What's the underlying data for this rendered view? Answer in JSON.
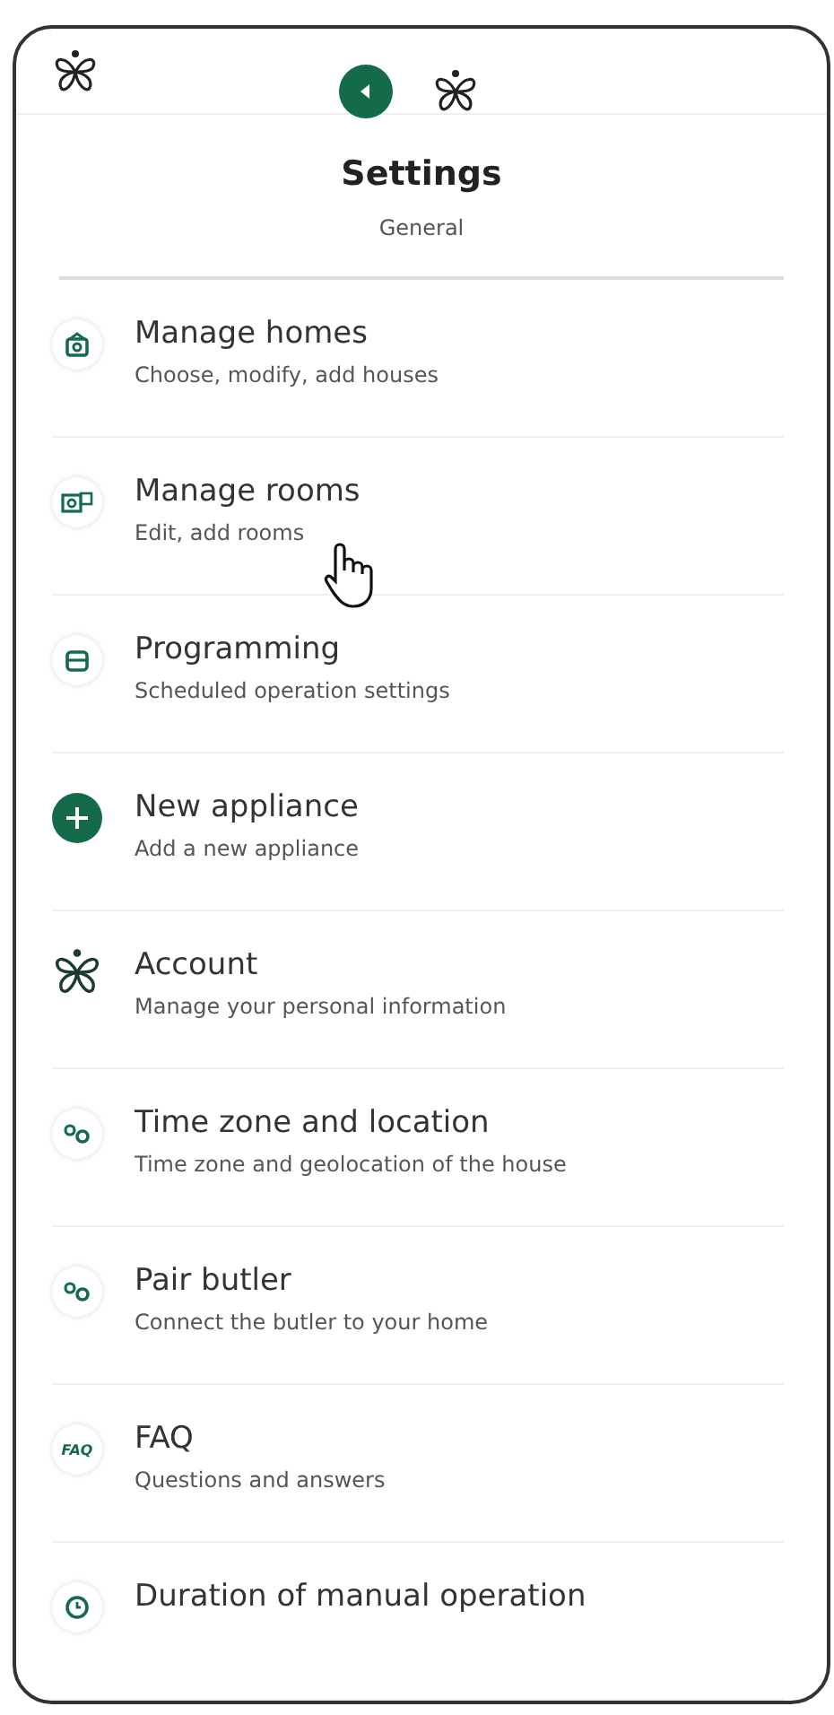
{
  "header": {
    "title": "Settings",
    "subtitle": "General"
  },
  "items": [
    {
      "kind": "home",
      "title": "Manage homes",
      "subtitle": "Choose, modify, add houses"
    },
    {
      "kind": "rooms",
      "title": "Manage rooms",
      "subtitle": "Edit, add rooms"
    },
    {
      "kind": "calendar",
      "title": "Programming",
      "subtitle": "Scheduled operation settings"
    },
    {
      "kind": "plus",
      "title": "New appliance",
      "subtitle": "Add a new appliance"
    },
    {
      "kind": "logo",
      "title": "Account",
      "subtitle": "Manage your personal information"
    },
    {
      "kind": "link",
      "title": "Time zone and location",
      "subtitle": "Time zone and geolocation of the house"
    },
    {
      "kind": "link",
      "title": "Pair butler",
      "subtitle": "Connect the butler to your home"
    },
    {
      "kind": "faq",
      "icon_text": "FAQ",
      "title": "FAQ",
      "subtitle": "Questions and answers"
    },
    {
      "kind": "clock",
      "title": "Duration of manual operation"
    }
  ]
}
